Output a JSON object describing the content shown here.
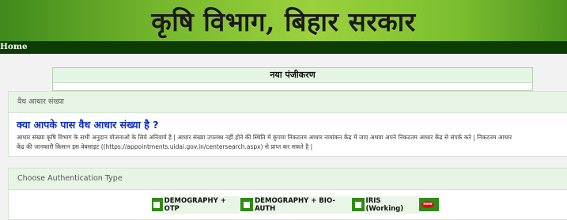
{
  "header": {
    "title": "कृषि विभाग, बिहार सरकार"
  },
  "nav": {
    "home": "Home"
  },
  "registration": {
    "title": "नया पंजीकरण"
  },
  "aadhaar_panel": {
    "heading": "वैध आधार संख्या",
    "question": "क्या आपके पास वैध आधार संख्या है ?",
    "line1": "आधार संख्या कृषि विभाग के सभी अनुदान योजनाओ के लिये अनिवार्य है | आधार संख्या उपलब्ध नहीं होने की स्थिति में कृपया निकटतम आधार नामांकन केंद्र में जाए अथवा अपने निकटतम आधार केंद्र से संपर्क करे | निकटतम आधार",
    "line2": "केंद्र की जानकारी किसान इस वेबसाइट ((https://appointments.uidai.gov.in/centersearch.aspx) से प्राप्त कर सकते है |"
  },
  "auth_panel": {
    "heading": "Choose Authentication Type",
    "options": [
      {
        "label": "DEMOGRAPHY + OTP",
        "checked": false
      },
      {
        "label": "DEMOGRAPHY + BIO-AUTH",
        "checked": false
      },
      {
        "label": "IRIS (Working)",
        "checked": false
      }
    ],
    "new_badge": "new"
  },
  "colors": {
    "nav_bg": "#0d3b05",
    "option_bar": "#2f8a16",
    "question_text": "#0c2bbf"
  }
}
